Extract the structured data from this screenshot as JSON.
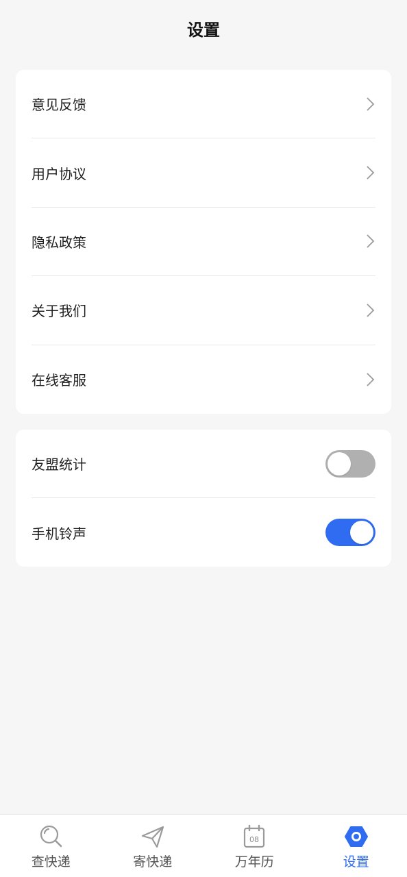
{
  "header": {
    "title": "设置"
  },
  "links": [
    {
      "label": "意见反馈"
    },
    {
      "label": "用户协议"
    },
    {
      "label": "隐私政策"
    },
    {
      "label": "关于我们"
    },
    {
      "label": "在线客服"
    }
  ],
  "toggles": [
    {
      "label": "友盟统计",
      "on": false
    },
    {
      "label": "手机铃声",
      "on": true
    }
  ],
  "tabs": [
    {
      "label": "查快递",
      "icon": "search-icon"
    },
    {
      "label": "寄快递",
      "icon": "paper-plane-icon"
    },
    {
      "label": "万年历",
      "icon": "calendar-icon",
      "calendar_day": "08"
    },
    {
      "label": "设置",
      "icon": "settings-hexagon-icon",
      "active": true
    }
  ],
  "colors": {
    "accent": "#2f6cf1",
    "toggle_off": "#b0b0b0",
    "background": "#f6f6f6"
  }
}
